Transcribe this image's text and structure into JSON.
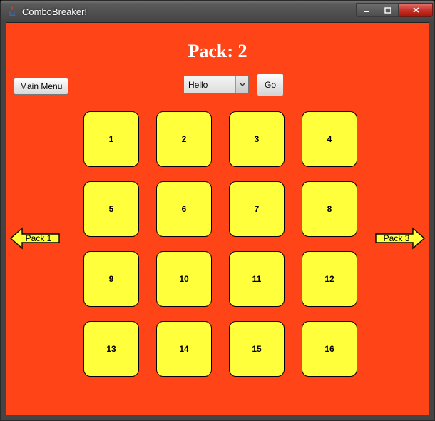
{
  "window": {
    "title": "ComboBreaker!"
  },
  "heading": "Pack: 2",
  "toolbar": {
    "main_menu_label": "Main Menu",
    "combo_selected": "Hello",
    "go_label": "Go"
  },
  "nav": {
    "prev_label": "Pack 1",
    "next_label": "Pack 3"
  },
  "levels": [
    "1",
    "2",
    "3",
    "4",
    "5",
    "6",
    "7",
    "8",
    "9",
    "10",
    "11",
    "12",
    "13",
    "14",
    "15",
    "16"
  ]
}
